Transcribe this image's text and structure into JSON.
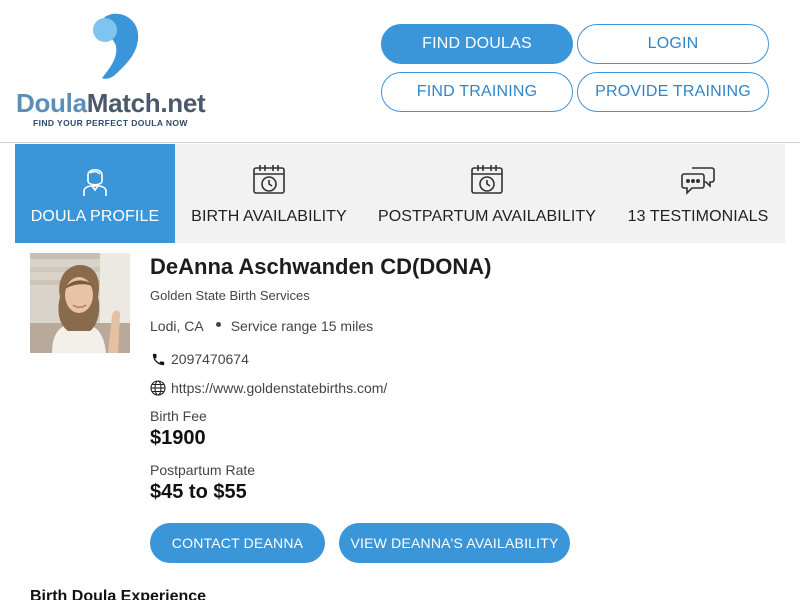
{
  "logo": {
    "name_part1": "Doula",
    "name_part2": "Match.net",
    "tagline": "FIND YOUR PERFECT DOULA NOW",
    "brand_color": "#5a8fba",
    "accent_color": "#3a95d9"
  },
  "nav": {
    "find_doulas": "FIND DOULAS",
    "login": "LOGIN",
    "find_training": "FIND TRAINING",
    "provide_training": "PROVIDE TRAINING"
  },
  "tabs": [
    {
      "label": "DOULA PROFILE",
      "icon": "doula-icon",
      "active": true
    },
    {
      "label": "BIRTH AVAILABILITY",
      "icon": "calendar-clock-icon",
      "active": false
    },
    {
      "label": "POSTPARTUM AVAILABILITY",
      "icon": "calendar-clock-icon",
      "active": false
    },
    {
      "label": "13 TESTIMONIALS",
      "icon": "chat-bubbles-icon",
      "active": false
    }
  ],
  "profile": {
    "name": "DeAnna Aschwanden CD(DONA)",
    "business": "Golden State Birth Services",
    "location": "Lodi, CA",
    "service_range": "Service range 15 miles",
    "phone": "2097470674",
    "website": "https://www.goldenstatebirths.com/",
    "birth_fee_label": "Birth Fee",
    "birth_fee": "$1900",
    "postpartum_label": "Postpartum Rate",
    "postpartum_rate": "$45 to $55",
    "contact_button": "CONTACT DEANNA",
    "availability_button": "VIEW DEANNA'S AVAILABILITY"
  },
  "sections": {
    "experience_title": "Birth Doula Experience"
  }
}
